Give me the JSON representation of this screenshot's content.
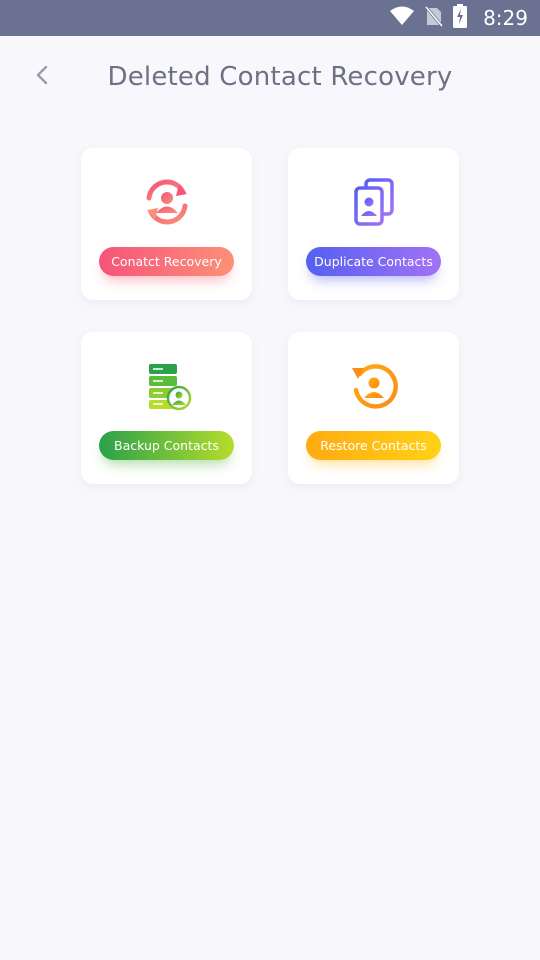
{
  "status_bar": {
    "time": "8:29",
    "icons": [
      "wifi-icon",
      "no-sim-icon",
      "battery-charging-icon"
    ]
  },
  "header": {
    "back_icon": "chevron-left-icon",
    "title": "Deleted Contact Recovery"
  },
  "cards": [
    {
      "label": "Conatct Recovery",
      "icon": "contact-recovery-icon",
      "accent": "#f6547a"
    },
    {
      "label": "Duplicate Contacts",
      "icon": "duplicate-contacts-icon",
      "accent": "#5560f0"
    },
    {
      "label": "Backup Contacts",
      "icon": "backup-contacts-icon",
      "accent": "#2aa14a"
    },
    {
      "label": "Restore Contacts",
      "icon": "restore-contacts-icon",
      "accent": "#ffaa12"
    }
  ]
}
